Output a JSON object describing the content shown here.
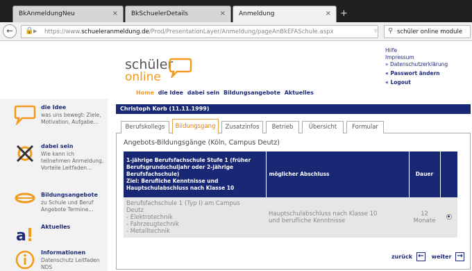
{
  "browser": {
    "tabs": [
      {
        "label": "BkAnmeldungNeu",
        "close": "×"
      },
      {
        "label": "BkSchuelerDetails",
        "close": "×"
      },
      {
        "label": "Anmeldung",
        "close": "×"
      }
    ],
    "new_tab": "+",
    "url_prefix": "https://www.",
    "url_domain": "schueleranmeldung.de",
    "url_path": "/Prod/PresentationLayer/Anmeldung/pageAnBkEFASchule.aspx",
    "search_query": "schüler online module",
    "icons": [
      "back-arrow-icon",
      "lock-icon",
      "info-icon",
      "dropdown-icon",
      "reload-icon",
      "search-icon"
    ]
  },
  "logo": {
    "line1": "schüler",
    "line2": "online",
    "brand_color": "#f39a1b"
  },
  "toplinks": {
    "hilfe": "Hilfe",
    "impressum": "Impressum",
    "datenschutz": "» Datenschutzerklärung",
    "passwort": "« Passwort ändern",
    "logout": "« Logout"
  },
  "mainnav": {
    "home": "Home",
    "idee": "die Idee",
    "dabei": "dabei sein",
    "angebote": "Bildungsangebote",
    "aktuelles": "Aktuelles"
  },
  "sidebar": {
    "items": [
      {
        "title": "die Idee",
        "desc": "was uns bewegt: Ziele, Motivation, Aufgabe...",
        "icon": "speech-bubble-icon"
      },
      {
        "title": "dabei sein",
        "desc": "Wie kann ich teilnehmen Anmeldung, Vorteile Leitfaden...",
        "icon": "crossed-circle-icon"
      },
      {
        "title": "Bildungsangebote",
        "desc": "zu Schule und Beruf Angebote Termine...",
        "icon": "orange-lens-icon"
      },
      {
        "title": "Aktuelles",
        "desc": "",
        "icon": "a-exclamation-icon"
      },
      {
        "title": "Informationen",
        "desc": "Datenschutz Leitfaden NDS",
        "icon": "info-circle-icon"
      }
    ]
  },
  "user": {
    "name": "Christoph Korb (11.11.1999)"
  },
  "tabs": [
    {
      "label": "Berufskollegs"
    },
    {
      "label": "Bildungsgang"
    },
    {
      "label": "Zusatzinfos"
    },
    {
      "label": "Betrieb"
    },
    {
      "label": "Übersicht"
    },
    {
      "label": "Formular"
    }
  ],
  "active_tab": "Bildungsgang",
  "panel": {
    "title": "Angebots-Bildungsgänge (Köln, Campus Deutz)",
    "header": {
      "col1_line1": "1-jährige Berufsfachschule Stufe 1 (früher",
      "col1_line2": "Berufsgrundschuljahr oder 2-jährige",
      "col1_line3": "Berufsfachschule)",
      "col1_line4": "Ziel: Berufliche Kenntnisse und",
      "col1_line5": "Hauptschulabschluss nach Klasse 10",
      "col2": "möglicher Abschluss",
      "col3": "Dauer"
    },
    "row": {
      "name_line1": "Berufsfachschule 1 (Typ I) am Campus",
      "name_line2": "Deutz",
      "name_line3": "- Elektrotechnik",
      "name_line4": "- Fahrzeugtechnik",
      "name_line5": "- Metalltechnik",
      "abschluss_line1": "Hauptschulabschluss nach Klasse 10",
      "abschluss_line2": "und berufliche Kenntnisse",
      "dauer_line1": "12",
      "dauer_line2": "Monate"
    },
    "back": "zurück",
    "next": "weiter"
  }
}
